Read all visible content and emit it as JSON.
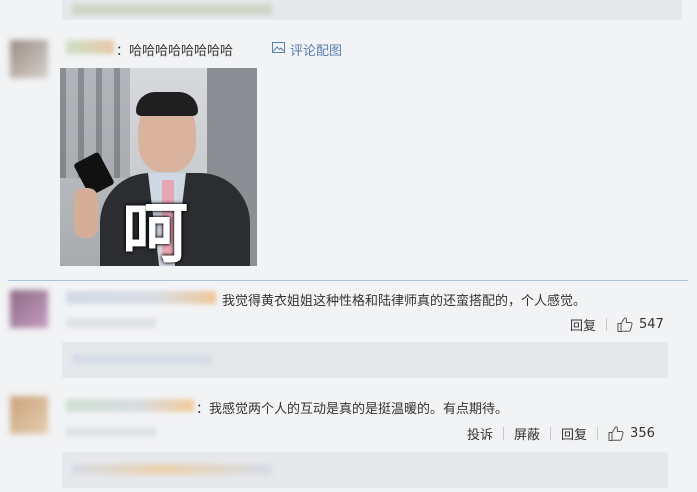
{
  "comments": [
    {
      "text": "：哈哈哈哈哈哈哈哈",
      "pic_link": "评论配图",
      "image_caption": "呵"
    },
    {
      "text": "我觉得黄衣姐姐这种性格和陆律师真的还蛮搭配的，个人感觉。",
      "reply_label": "回复",
      "like_count": "547"
    },
    {
      "text": "：我感觉两个人的互动是真的是挺温暖的。有点期待。",
      "report_label": "投诉",
      "block_label": "屏蔽",
      "reply_label": "回复",
      "like_count": "356"
    }
  ],
  "icons": {
    "picture": "picture-icon",
    "like": "thumbs-up-icon"
  },
  "colors": {
    "link": "#5a7eb0",
    "divider": "#a9c3df",
    "background": "#f2f3f5"
  }
}
